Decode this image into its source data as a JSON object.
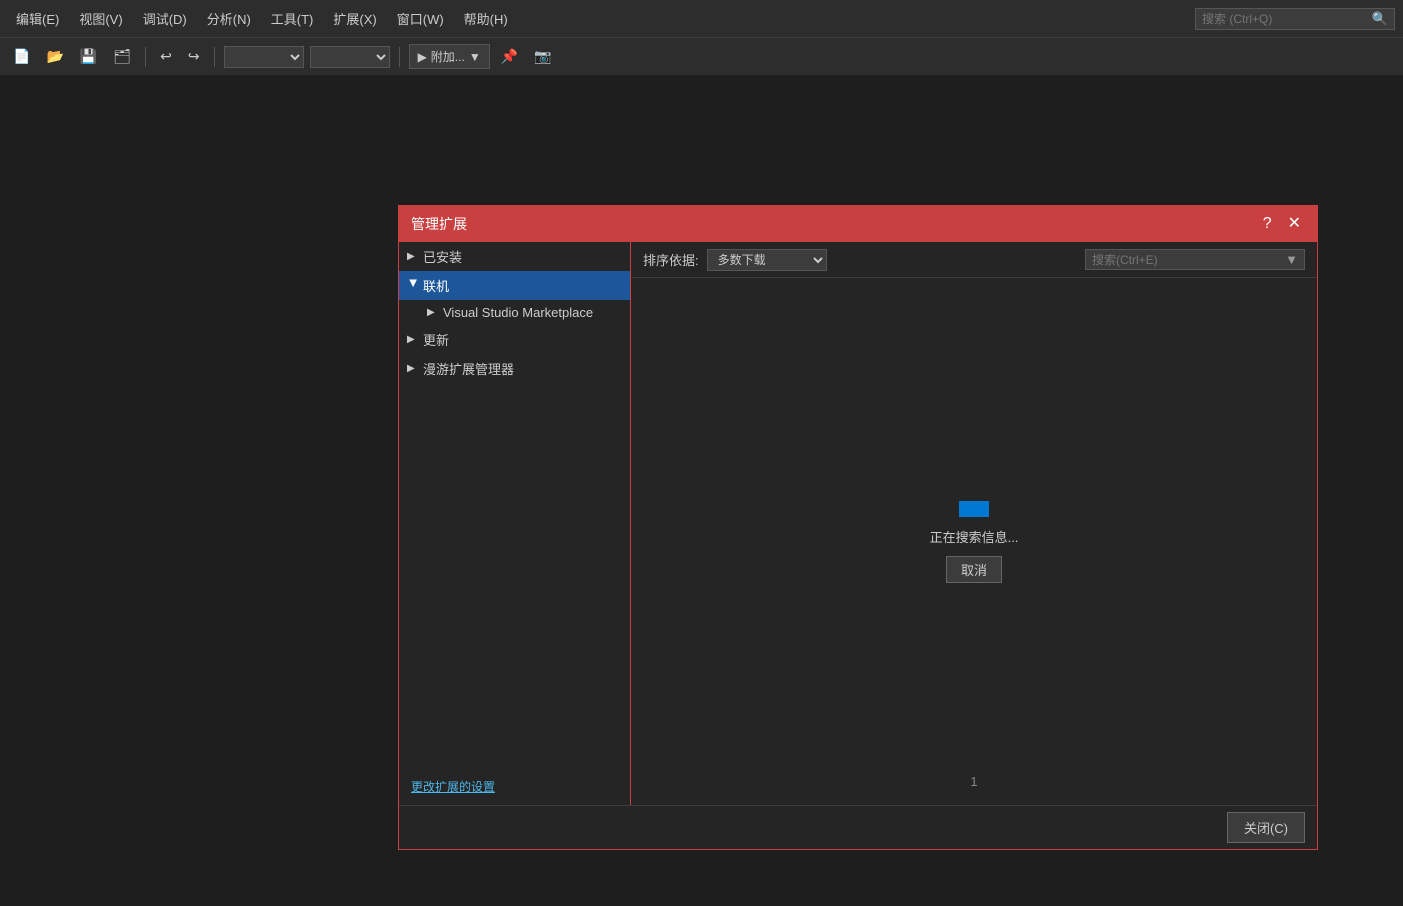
{
  "menubar": {
    "items": [
      {
        "label": "编辑(E)"
      },
      {
        "label": "视图(V)"
      },
      {
        "label": "调试(D)"
      },
      {
        "label": "分析(N)"
      },
      {
        "label": "工具(T)"
      },
      {
        "label": "扩展(X)"
      },
      {
        "label": "窗口(W)"
      },
      {
        "label": "帮助(H)"
      }
    ],
    "search_placeholder": "搜索 (Ctrl+Q)"
  },
  "toolbar": {
    "attach_label": "附加...",
    "attach_dropdown": "▼"
  },
  "dialog": {
    "title": "管理扩展",
    "help_btn": "?",
    "close_btn": "✕",
    "tree": {
      "installed": {
        "label": "已安装",
        "arrow": "▶",
        "selected": false
      },
      "online": {
        "label": "联机",
        "arrow": "◀",
        "selected": true
      },
      "marketplace": {
        "label": "Visual Studio Marketplace"
      },
      "updates": {
        "label": "更新",
        "arrow": "▶"
      },
      "roaming": {
        "label": "漫游扩展管理器",
        "arrow": "▶"
      }
    },
    "change_settings": "更改扩展的设置",
    "sort": {
      "label": "排序依据:",
      "value": "多数下载"
    },
    "search_placeholder": "搜索(Ctrl+E)",
    "loading_text": "正在搜索信息...",
    "cancel_btn": "取消",
    "page_number": "1",
    "close_footer_btn": "关闭(C)"
  }
}
